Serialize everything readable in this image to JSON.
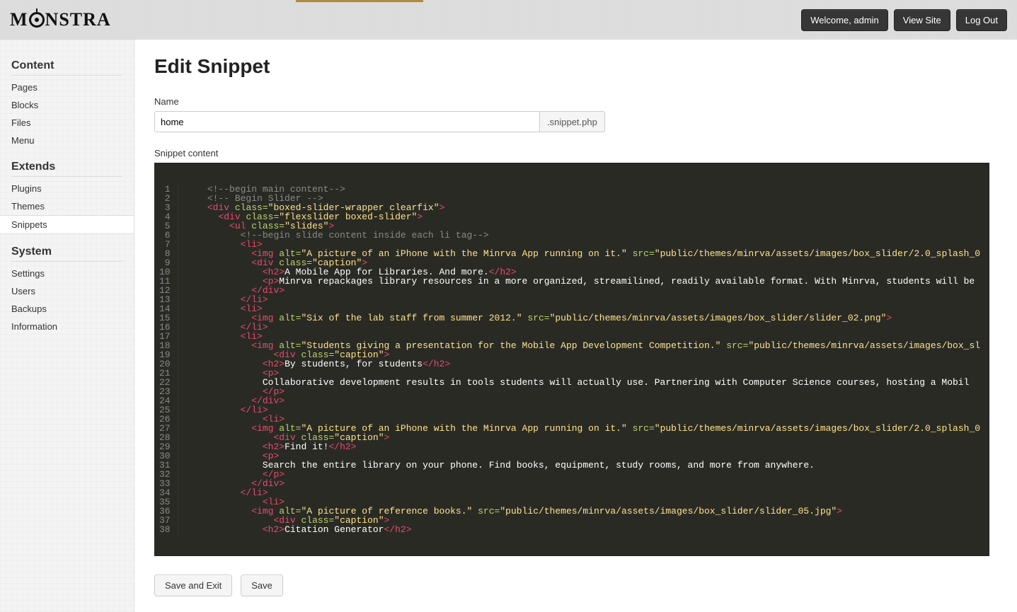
{
  "header": {
    "brand": "MONSTRA",
    "welcome": "Welcome, admin",
    "view_site": "View Site",
    "logout": "Log Out"
  },
  "sidebar": {
    "sections": [
      {
        "title": "Content",
        "items": [
          "Pages",
          "Blocks",
          "Files",
          "Menu"
        ],
        "active": null
      },
      {
        "title": "Extends",
        "items": [
          "Plugins",
          "Themes",
          "Snippets"
        ],
        "active": "Snippets"
      },
      {
        "title": "System",
        "items": [
          "Settings",
          "Users",
          "Backups",
          "Information"
        ],
        "active": null
      }
    ]
  },
  "page": {
    "title": "Edit Snippet",
    "name_label": "Name",
    "name_value": "home",
    "name_suffix": ".snippet.php",
    "content_label": "Snippet content",
    "save_exit": "Save and Exit",
    "save": "Save"
  },
  "code_lines": [
    [
      [
        "cm",
        "<!--begin main content-->"
      ]
    ],
    [
      [
        "cm",
        "<!-- Begin Slider -->"
      ]
    ],
    [
      [
        "tag",
        "<div"
      ],
      [
        "attr",
        " class="
      ],
      [
        "val",
        "\"boxed-slider-wrapper clearfix\""
      ],
      [
        "tag",
        ">"
      ]
    ],
    [
      [
        "txt",
        "  "
      ],
      [
        "tag",
        "<div"
      ],
      [
        "attr",
        " class="
      ],
      [
        "val",
        "\"flexslider boxed-slider\""
      ],
      [
        "tag",
        ">"
      ]
    ],
    [
      [
        "txt",
        "    "
      ],
      [
        "tag",
        "<ul"
      ],
      [
        "attr",
        " class="
      ],
      [
        "val",
        "\"slides\""
      ],
      [
        "tag",
        ">"
      ]
    ],
    [
      [
        "txt",
        "      "
      ],
      [
        "cm",
        "<!--begin slide content inside each li tag-->"
      ]
    ],
    [
      [
        "txt",
        "      "
      ],
      [
        "tag",
        "<li>"
      ]
    ],
    [
      [
        "txt",
        "        "
      ],
      [
        "tag",
        "<img"
      ],
      [
        "attr",
        " alt="
      ],
      [
        "val",
        "\"A picture of an iPhone with the Minrva App running on it.\""
      ],
      [
        "attr",
        " src="
      ],
      [
        "val",
        "\"public/themes/minrva/assets/images/box_slider/2.0_splash_0"
      ]
    ],
    [
      [
        "txt",
        "        "
      ],
      [
        "tag",
        "<div"
      ],
      [
        "attr",
        " class="
      ],
      [
        "val",
        "\"caption\""
      ],
      [
        "tag",
        ">"
      ]
    ],
    [
      [
        "txt",
        "          "
      ],
      [
        "tag",
        "<h2>"
      ],
      [
        "txt",
        "A Mobile App for Libraries. And more."
      ],
      [
        "tag",
        "</h2>"
      ]
    ],
    [
      [
        "txt",
        "          "
      ],
      [
        "tag",
        "<p>"
      ],
      [
        "txt",
        "Minrva repackages library resources in a more organized, streamilined, readily available format. With Minrva, students will be "
      ]
    ],
    [
      [
        "txt",
        "        "
      ],
      [
        "tag",
        "</div>"
      ]
    ],
    [
      [
        "txt",
        "      "
      ],
      [
        "tag",
        "</li>"
      ]
    ],
    [
      [
        "txt",
        "      "
      ],
      [
        "tag",
        "<li>"
      ]
    ],
    [
      [
        "txt",
        "        "
      ],
      [
        "tag",
        "<img"
      ],
      [
        "attr",
        " alt="
      ],
      [
        "val",
        "\"Six of the lab staff from summer 2012.\""
      ],
      [
        "attr",
        " src="
      ],
      [
        "val",
        "\"public/themes/minrva/assets/images/box_slider/slider_02.png\""
      ],
      [
        "tag",
        ">"
      ]
    ],
    [
      [
        "txt",
        "      "
      ],
      [
        "tag",
        "</li>"
      ]
    ],
    [
      [
        "txt",
        "      "
      ],
      [
        "tag",
        "<li>"
      ]
    ],
    [
      [
        "txt",
        "        "
      ],
      [
        "tag",
        "<img"
      ],
      [
        "attr",
        " alt="
      ],
      [
        "val",
        "\"Students giving a presentation for the Mobile App Development Competition.\""
      ],
      [
        "attr",
        " src="
      ],
      [
        "val",
        "\"public/themes/minrva/assets/images/box_sl"
      ]
    ],
    [
      [
        "txt",
        "            "
      ],
      [
        "tag",
        "<div"
      ],
      [
        "attr",
        " class="
      ],
      [
        "val",
        "\"caption\""
      ],
      [
        "tag",
        ">"
      ]
    ],
    [
      [
        "txt",
        "          "
      ],
      [
        "tag",
        "<h2>"
      ],
      [
        "txt",
        "By students, for students"
      ],
      [
        "tag",
        "</h2>"
      ]
    ],
    [
      [
        "txt",
        "          "
      ],
      [
        "tag",
        "<p>"
      ]
    ],
    [
      [
        "txt",
        "          Collaborative development results in tools students will actually use. Partnering with Computer Science courses, hosting a Mobil"
      ]
    ],
    [
      [
        "txt",
        "          "
      ],
      [
        "tag",
        "</p>"
      ]
    ],
    [
      [
        "txt",
        "        "
      ],
      [
        "tag",
        "</div>"
      ]
    ],
    [
      [
        "txt",
        "      "
      ],
      [
        "tag",
        "</li>"
      ]
    ],
    [
      [
        "txt",
        "          "
      ],
      [
        "tag",
        "<li>"
      ]
    ],
    [
      [
        "txt",
        "        "
      ],
      [
        "tag",
        "<img"
      ],
      [
        "attr",
        " alt="
      ],
      [
        "val",
        "\"A picture of an iPhone with the Minrva App running on it.\""
      ],
      [
        "attr",
        " src="
      ],
      [
        "val",
        "\"public/themes/minrva/assets/images/box_slider/2.0_splash_0"
      ]
    ],
    [
      [
        "txt",
        "            "
      ],
      [
        "tag",
        "<div"
      ],
      [
        "attr",
        " class="
      ],
      [
        "val",
        "\"caption\""
      ],
      [
        "tag",
        ">"
      ]
    ],
    [
      [
        "txt",
        "          "
      ],
      [
        "tag",
        "<h2>"
      ],
      [
        "txt",
        "Find it!"
      ],
      [
        "tag",
        "</h2>"
      ]
    ],
    [
      [
        "txt",
        "          "
      ],
      [
        "tag",
        "<p>"
      ]
    ],
    [
      [
        "txt",
        "          Search the entire library on your phone. Find books, equipment, study rooms, and more from anywhere."
      ]
    ],
    [
      [
        "txt",
        "          "
      ],
      [
        "tag",
        "</p>"
      ]
    ],
    [
      [
        "txt",
        "        "
      ],
      [
        "tag",
        "</div>"
      ]
    ],
    [
      [
        "txt",
        "      "
      ],
      [
        "tag",
        "</li>"
      ]
    ],
    [
      [
        "txt",
        "          "
      ],
      [
        "tag",
        "<li>"
      ]
    ],
    [
      [
        "txt",
        "        "
      ],
      [
        "tag",
        "<img"
      ],
      [
        "attr",
        " alt="
      ],
      [
        "val",
        "\"A picture of reference books.\""
      ],
      [
        "attr",
        " src="
      ],
      [
        "val",
        "\"public/themes/minrva/assets/images/box_slider/slider_05.jpg\""
      ],
      [
        "tag",
        ">"
      ]
    ],
    [
      [
        "txt",
        "            "
      ],
      [
        "tag",
        "<div"
      ],
      [
        "attr",
        " class="
      ],
      [
        "val",
        "\"caption\""
      ],
      [
        "tag",
        ">"
      ]
    ],
    [
      [
        "txt",
        "          "
      ],
      [
        "tag",
        "<h2>"
      ],
      [
        "txt",
        "Citation Generator"
      ],
      [
        "tag",
        "</h2>"
      ]
    ]
  ]
}
